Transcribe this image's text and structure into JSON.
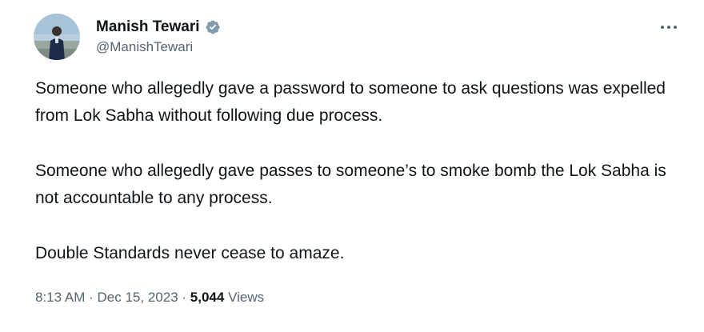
{
  "author": {
    "display_name": "Manish Tewari",
    "handle": "@ManishTewari",
    "verified_badge_color": "#829aab"
  },
  "tweet": {
    "paragraphs": [
      "Someone who allegedly gave a password to someone to ask questions was expelled from Lok Sabha without following due process.",
      "Someone who allegedly gave passes to someone’s to smoke bomb the Lok Sabha is not accountable to any process.",
      "Double Standards never cease to amaze."
    ]
  },
  "meta": {
    "time": "8:13 AM",
    "separator": "·",
    "date": "Dec 15, 2023",
    "views_count": "5,044",
    "views_label": "Views"
  },
  "icons": {
    "more": "more-options-icon",
    "verified": "verified-badge-icon"
  },
  "colors": {
    "text_primary": "#0f1419",
    "text_secondary": "#536471"
  }
}
